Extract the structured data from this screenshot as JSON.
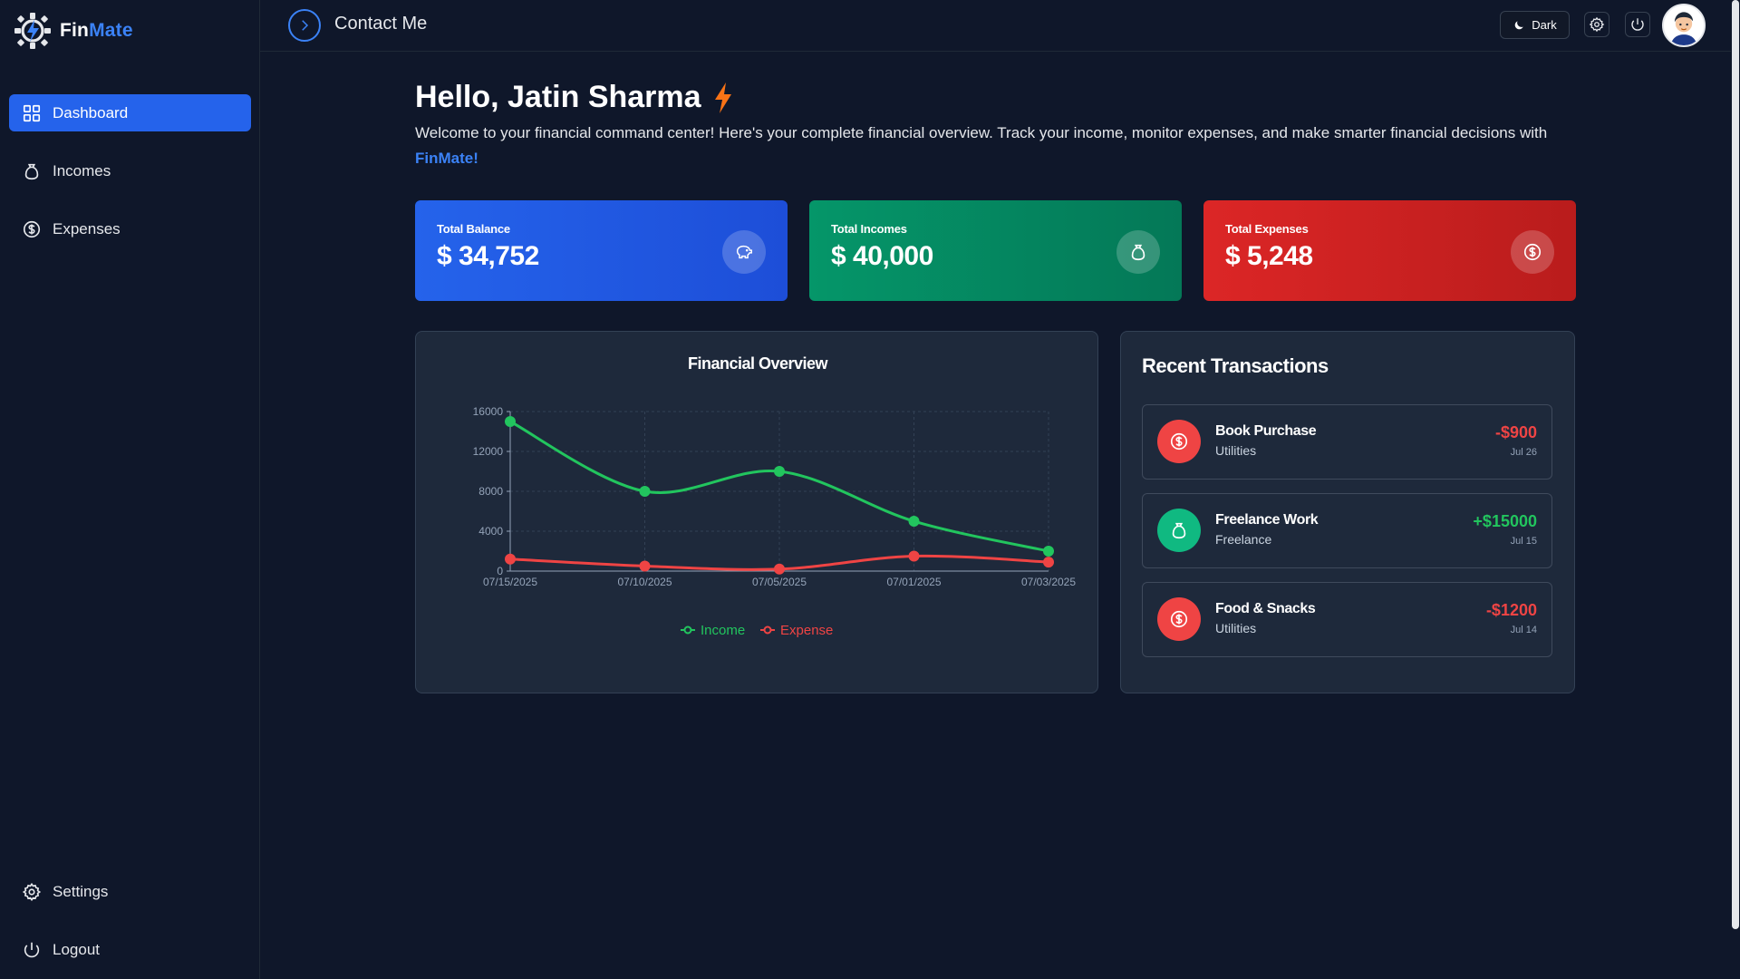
{
  "app": {
    "brand_part1": "Fin",
    "brand_part2": "Mate"
  },
  "sidebar": {
    "items": [
      {
        "label": "Dashboard",
        "icon": "dashboard-icon",
        "active": true
      },
      {
        "label": "Incomes",
        "icon": "money-bag-icon"
      },
      {
        "label": "Expenses",
        "icon": "dollar-circle-icon"
      }
    ],
    "bottom": [
      {
        "label": "Settings",
        "icon": "gear-icon"
      },
      {
        "label": "Logout",
        "icon": "power-icon"
      }
    ]
  },
  "header": {
    "title": "Contact Me",
    "theme_label": "Dark"
  },
  "main": {
    "greeting": "Hello, Jatin Sharma",
    "welcome_text": "Welcome to your financial command center! Here's your complete financial overview. Track your income, monitor expenses, and make smarter financial decisions with ",
    "welcome_brand": "FinMate!"
  },
  "cards": [
    {
      "label": "Total Balance",
      "value": "$ 34,752",
      "icon": "piggy-bank-icon",
      "color": "#2563eb"
    },
    {
      "label": "Total Incomes",
      "value": "$ 40,000",
      "icon": "money-bag-icon",
      "color": "#059669"
    },
    {
      "label": "Total Expenses",
      "value": "$ 5,248",
      "icon": "dollar-circle-icon",
      "color": "#dc2626"
    }
  ],
  "chart_data": {
    "type": "line",
    "title": "Financial Overview",
    "x": [
      "07/15/2025",
      "07/10/2025",
      "07/05/2025",
      "07/01/2025",
      "07/03/2025"
    ],
    "ylim": [
      0,
      16000
    ],
    "yticks": [
      0,
      4000,
      8000,
      12000,
      16000
    ],
    "grid": true,
    "legend": "bottom-center",
    "series": [
      {
        "name": "Income",
        "color": "#22c55e",
        "values": [
          15000,
          8000,
          10000,
          5000,
          2000
        ]
      },
      {
        "name": "Expense",
        "color": "#ef4444",
        "values": [
          1200,
          500,
          200,
          1500,
          900
        ]
      }
    ]
  },
  "transactions": {
    "title": "Recent Transactions",
    "items": [
      {
        "name": "Book Purchase",
        "category": "Utilities",
        "amount": "-$900",
        "date": "Jul 26",
        "type": "expense"
      },
      {
        "name": "Freelance Work",
        "category": "Freelance",
        "amount": "+$15000",
        "date": "Jul 15",
        "type": "income"
      },
      {
        "name": "Food & Snacks",
        "category": "Utilities",
        "amount": "-$1200",
        "date": "Jul 14",
        "type": "expense"
      }
    ]
  }
}
